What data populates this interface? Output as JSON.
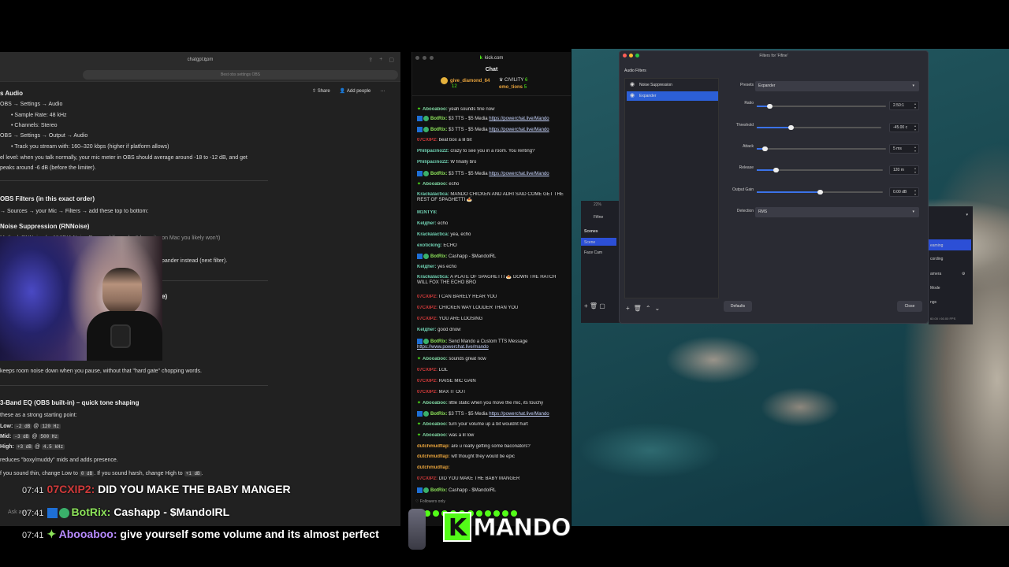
{
  "browser": {
    "url": "chatgpt.com",
    "search_pill": "Best obs settings OBS",
    "share_label": "Share",
    "add_people_label": "Add people",
    "more_label": "···",
    "doc": {
      "audio_heading": "s Audio",
      "line1": "OBS → Settings → Audio",
      "line2": "Sample Rate: 48 kHz",
      "line3": "Channels: Stereo",
      "line4": "OBS → Settings → Output → Audio",
      "line5": "Track you stream with: 160–320 kbps (higher if platform allows)",
      "line6": "el level: when you talk normally, your mic meter in OBS should average around -18 to -12 dB, and get",
      "line7": "peaks around -6 dB (before the limiter).",
      "filters_heading": "OBS Filters (in this exact order)",
      "line8": "→ Sources → your Mic → Filters → add these top to bottom:",
      "noise_heading": "Noise Suppression (RNNoise)",
      "line9": "Method: RNNoise (or NVIDIA Noise Removal if you don't have it—on Mac you likely won't)",
      "line10": "pander instead (next filter).",
      "line11": "e)",
      "line12": "keeps room noise down when you pause, without that \"hard gate\" chopping words.",
      "eq_heading": "3-Band EQ (OBS built-in) – quick tone shaping",
      "line13": "these as a strong starting point:",
      "low_label": "Low:",
      "low_code1": "-2 dB",
      "low_at": "@",
      "low_code2": "120 Hz",
      "mid_label": "Mid:",
      "mid_code1": "-3 dB",
      "mid_code2": "500 Hz",
      "high_label": "High:",
      "high_code1": "+3 dB",
      "high_code2": "4.5 kHz",
      "line14": "reduces \"boxy/muddy\" mids and adds presence.",
      "line15a": "f you sound thin, change Low to",
      "line15code1": "0 dB",
      "line15b": ". If you sound harsh, change High to",
      "line15code2": "+1 dB",
      "line15c": ".",
      "ask_placeholder": "Ask any..."
    }
  },
  "chat": {
    "window_title": "kick.com",
    "kick_k": "k",
    "header": "Chat",
    "gifters": [
      {
        "name": "give_diamond_64",
        "count": "12"
      },
      {
        "name": "CIVILITY",
        "count": "6"
      },
      {
        "name": "emo_tions",
        "count": "5"
      }
    ],
    "messages": [
      {
        "user": "Abooaboo:",
        "text": " yeah sounds fine now"
      },
      {
        "user": "BotRix:",
        "text": " $3 TTS - $5 Media ",
        "link": "https://powerchat.live/Mando"
      },
      {
        "user": "BotRix:",
        "text": " $3 TTS - $5 Media ",
        "link": "https://powerchat.live/Mando"
      },
      {
        "user": "07CXIP2:",
        "text": " beat box a lil bit"
      },
      {
        "user": "Philipacino22:",
        "text": " crazy to see you in a room. You renting?"
      },
      {
        "user": "Philipacino22:",
        "text": " W finally bro"
      },
      {
        "user": "BotRix:",
        "text": " $3 TTS - $5 Media ",
        "link": "https://powerchat.live/Mando"
      },
      {
        "user": "Abooaboo:",
        "text": " echo"
      },
      {
        "user": "Krackalactica:",
        "text": " MANDO CHICKEN AND ADRI SAID COME GET THE REST OF SPAGHETTI 🍝"
      },
      {
        "user": "M1NTY8:",
        "text": ""
      },
      {
        "user": "Kelдher:",
        "text": " echo"
      },
      {
        "user": "Krackalactica:",
        "text": " yea, echo"
      },
      {
        "user": "exoticking:",
        "text": " ECHO"
      },
      {
        "user": "BotRix:",
        "text": " Cashapp - $MandoIRL"
      },
      {
        "user": "Kelдher:",
        "text": " yes echo"
      },
      {
        "user": "Krackalactica:",
        "text": " A PLATE OF SPAGHETTI 🍝 DOWN THE HATCH WILL FOX THE ECHO BRO"
      },
      {
        "user": "07CXIP2:",
        "text": " I CAN BARELY HEAR YOU"
      },
      {
        "user": "07CXIP2:",
        "text": " CHICKEN WAY LOUDER THAN YOU"
      },
      {
        "user": "07CXIP2:",
        "text": " YOU ARE LOOSING"
      },
      {
        "user": "Kelдher:",
        "text": " good dnow"
      },
      {
        "user": "BotRix:",
        "text": " Send Mando a Custom TTS Message ",
        "link": "https://www.powerchat.live/mando"
      },
      {
        "user": "Abooaboo:",
        "text": " sounds great now"
      },
      {
        "user": "07CXIP2:",
        "text": " LOL"
      },
      {
        "user": "07CXIP2:",
        "text": " RAISE MIC GAIN"
      },
      {
        "user": "07CXIP2:",
        "text": " MAX IT OUT"
      },
      {
        "user": "Abooaboo:",
        "text": " little static when you move the mic, its touchy"
      },
      {
        "user": "BotRix:",
        "text": " $3 TTS - $5 Media ",
        "link": "https://powerchat.live/Mando"
      },
      {
        "user": "Abooaboo:",
        "text": " turn your volume up a bit wouldnt hurt"
      },
      {
        "user": "Abooaboo:",
        "text": " was a lil low"
      },
      {
        "user": "dutchmudflap:",
        "text": " are u really getting some baconators?"
      },
      {
        "user": "dutchmudflap:",
        "text": " wtf thought they would be epic"
      },
      {
        "user": "dutchmudflap:",
        "text": ""
      },
      {
        "user": "07CXIP2:",
        "text": " DID YOU MAKE THE BABY MANGER"
      },
      {
        "user": "BotRix:",
        "text": " Cashapp - $MandoIRL"
      }
    ],
    "followers_only": "Followers only"
  },
  "obs": {
    "zoom": "22%",
    "source_fifine": "Fifine",
    "scenes_label": "Scenes",
    "scene_scene": "Scene",
    "scene_facecam": "Face Cam",
    "right_streaming": "eaming",
    "right_recording": "cording",
    "right_camera": "amera",
    "right_mode": "Mode",
    "right_settings": "ngs",
    "fps": "60.00 / 60.00 FPS"
  },
  "filters_dialog": {
    "title": "Filters for 'Fifine'",
    "audio_filters_label": "Audio Filters",
    "items": [
      "Noise Suppression",
      "Expander"
    ],
    "presets_label": "Presets",
    "presets_value": "Expander",
    "ratio_label": "Ratio",
    "ratio_value": "2.50:1",
    "ratio_level": 0.1,
    "threshold_label": "Threshold",
    "threshold_value": "-45.00 c",
    "threshold_level": 0.27,
    "attack_label": "Attack",
    "attack_value": "5 ms",
    "attack_level": 0.06,
    "release_label": "Release",
    "release_value": "120 m",
    "release_level": 0.15,
    "output_gain_label": "Output Gain",
    "output_gain_value": "0.00 dB",
    "output_gain_level": 0.5,
    "detection_label": "Detection",
    "detection_value": "RMS",
    "defaults_label": "Defaults",
    "close_label": "Close"
  },
  "overlay": {
    "line1": {
      "time": "07:41",
      "user": "07CXIP2:",
      "text": "DID YOU MAKE THE BABY MANGER"
    },
    "line2": {
      "time": "07:41",
      "user": "BotRix:",
      "text": "Cashapp - $MandoIRL"
    },
    "line3": {
      "time": "07:41",
      "user": "Abooaboo:",
      "text": "give yourself some volume and its almost perfect"
    },
    "brand": "MANDO",
    "brand_k": "K"
  }
}
